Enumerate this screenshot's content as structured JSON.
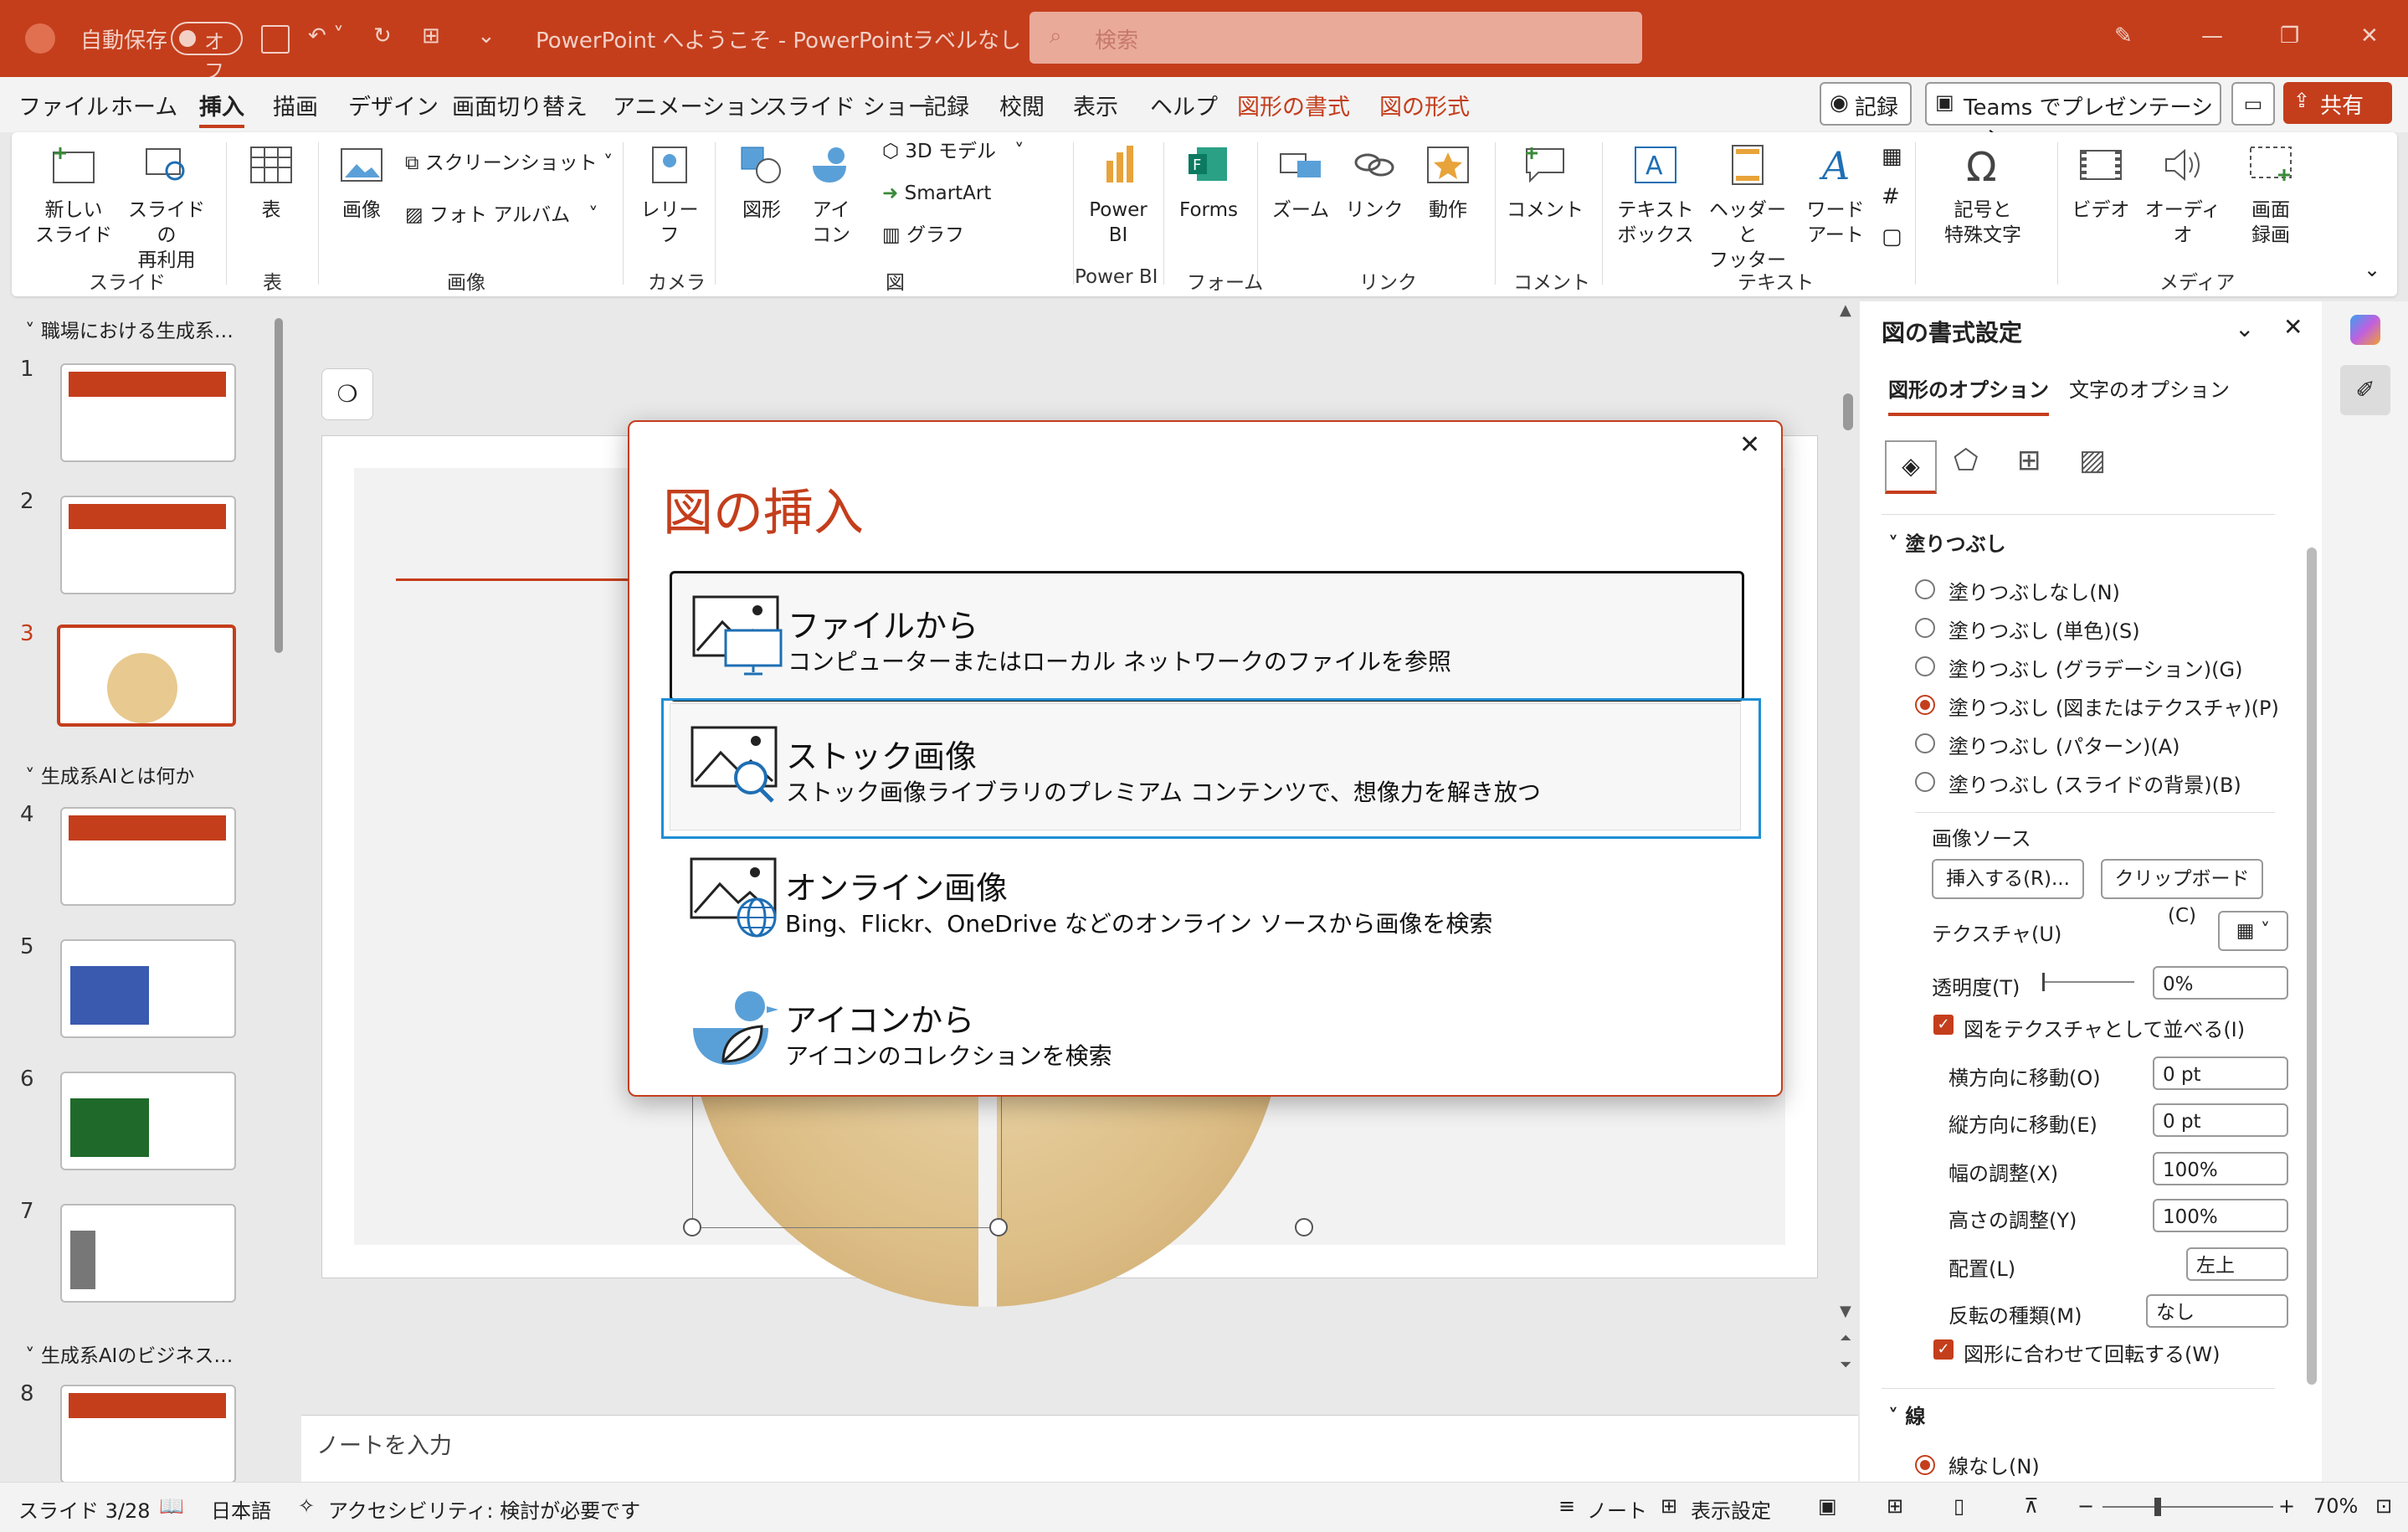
{
  "titlebar": {
    "autosave": "自動保存",
    "autosave_state": "オフ",
    "doc_title": "PowerPoint へようこそ  -  PowerPoint",
    "label": "ラベルなし",
    "search_placeholder": "検索"
  },
  "tabs": [
    "ファイル",
    "ホーム",
    "挿入",
    "描画",
    "デザイン",
    "画面切り替え",
    "アニメーション",
    "スライド ショー",
    "記録",
    "校閲",
    "表示",
    "ヘルプ",
    "図形の書式",
    "図の形式"
  ],
  "tab_right": {
    "record": "記録",
    "teams": "Teams でプレゼンテーション",
    "share": "共有"
  },
  "ribbon": {
    "new_slide": "新しい\nスライド",
    "reuse": "スライドの\n再利用",
    "table": "表",
    "image": "画像",
    "screenshot": "スクリーンショット",
    "photo_album": "フォト アルバム",
    "cameo": "レリー\nフ",
    "shapes": "図形",
    "icons": "アイ\nコン",
    "model3d": "3D モデル",
    "smartart": "SmartArt",
    "chart": "グラフ",
    "powerbi": "Power\nBI",
    "forms": "Forms",
    "zoom": "ズーム",
    "link": "リンク",
    "action": "動作",
    "comment": "コメント",
    "textbox": "テキスト\nボックス",
    "header_footer": "ヘッダーと\nフッター",
    "wordart": "ワード\nアート",
    "symbols": "記号と\n特殊文字",
    "video": "ビデオ",
    "audio": "オーディオ",
    "screen_rec": "画面\n録画",
    "groups": [
      "スライド",
      "表",
      "画像",
      "カメラ",
      "図",
      "Power BI",
      "フォーム",
      "リンク",
      "コメント",
      "テキスト",
      "メディア"
    ]
  },
  "thumbnails": {
    "sections": [
      "職場における生成系…",
      "生成系AIとは何か",
      "生成系AIのビジネス…"
    ],
    "slides": [
      "1",
      "2",
      "3",
      "4",
      "5",
      "6",
      "7",
      "8"
    ]
  },
  "notes_placeholder": "ノートを入力",
  "dialog": {
    "title": "図の挿入",
    "options": [
      {
        "title": "ファイルから",
        "desc": "コンピューターまたはローカル ネットワークのファイルを参照"
      },
      {
        "title": "ストック画像",
        "desc": "ストック画像ライブラリのプレミアム コンテンツで、想像力を解き放つ"
      },
      {
        "title": "オンライン画像",
        "desc": "Bing、Flickr、OneDrive などのオンライン ソースから画像を検索"
      },
      {
        "title": "アイコンから",
        "desc": "アイコンのコレクションを検索"
      }
    ]
  },
  "pane": {
    "title": "図の書式設定",
    "tab1": "図形のオプション",
    "tab2": "文字のオプション",
    "fill_header": "塗りつぶし",
    "fill_options": [
      "塗りつぶしなし(N)",
      "塗りつぶし (単色)(S)",
      "塗りつぶし (グラデーション)(G)",
      "塗りつぶし (図またはテクスチャ)(P)",
      "塗りつぶし (パターン)(A)",
      "塗りつぶし (スライドの背景)(B)"
    ],
    "image_source": "画像ソース",
    "insert_btn": "挿入する(R)...",
    "clipboard_btn": "クリップボード(C)",
    "texture": "テクスチャ(U)",
    "transparency": "透明度(T)",
    "transparency_val": "0%",
    "tile": "図をテクスチャとして並べる(I)",
    "offset_x": "横方向に移動(O)",
    "offset_x_val": "0 pt",
    "offset_y": "縦方向に移動(E)",
    "offset_y_val": "0 pt",
    "scale_x": "幅の調整(X)",
    "scale_x_val": "100%",
    "scale_y": "高さの調整(Y)",
    "scale_y_val": "100%",
    "align": "配置(L)",
    "align_val": "左上",
    "mirror": "反転の種類(M)",
    "mirror_val": "なし",
    "rotate": "図形に合わせて回転する(W)",
    "line_header": "線",
    "line_none": "線なし(N)"
  },
  "status": {
    "slide": "スライド 3/28",
    "lang": "日本語",
    "access": "アクセシビリティ: 検討が必要です",
    "notes": "ノート",
    "display": "表示設定",
    "zoom": "70%"
  },
  "colors": {
    "accent": "#c43e1c",
    "select": "#1e8fd4"
  }
}
